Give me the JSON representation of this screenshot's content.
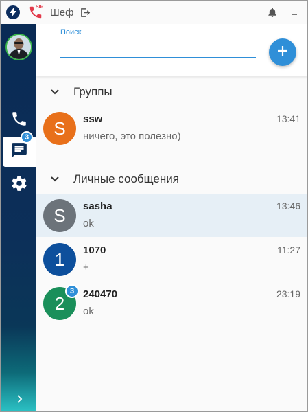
{
  "titlebar": {
    "user_name": "Шеф",
    "sip_label": "SIP"
  },
  "icons": {
    "bolt": "lightning-icon",
    "sip": "phone-sip-icon",
    "logout": "logout-icon",
    "bell": "bell-icon",
    "minimize": "minimize-icon",
    "phone": "phone-icon",
    "chat": "chat-icon",
    "gear": "gear-icon",
    "add": "plus-icon",
    "chevron": "chevron-down-icon",
    "expand": "chevron-right-icon"
  },
  "sidebar": {
    "chat_badge": "3"
  },
  "search": {
    "label": "Поиск",
    "value": ""
  },
  "sections": {
    "groups": "Группы",
    "personal": "Личные сообщения"
  },
  "conversations": {
    "groups": [
      {
        "initial": "S",
        "name": "ssw",
        "message": "ничего, это полезно)",
        "time": "13:41",
        "color": "#e8701a"
      }
    ],
    "personal": [
      {
        "initial": "S",
        "name": "sasha",
        "message": "ok",
        "time": "13:46",
        "color": "#6c737a",
        "active": true
      },
      {
        "initial": "1",
        "name": "1070",
        "message": "+",
        "time": "11:27",
        "color": "#0d4f9c"
      },
      {
        "initial": "2",
        "name": "240470",
        "message": "ok",
        "time": "23:19",
        "color": "#1a8f5a",
        "badge": "3"
      }
    ]
  },
  "colors": {
    "accent": "#2f8fd8",
    "sidebar_top": "#0a2b55",
    "sidebar_bottom": "#2bc1c4",
    "sip_red": "#e2394a"
  }
}
